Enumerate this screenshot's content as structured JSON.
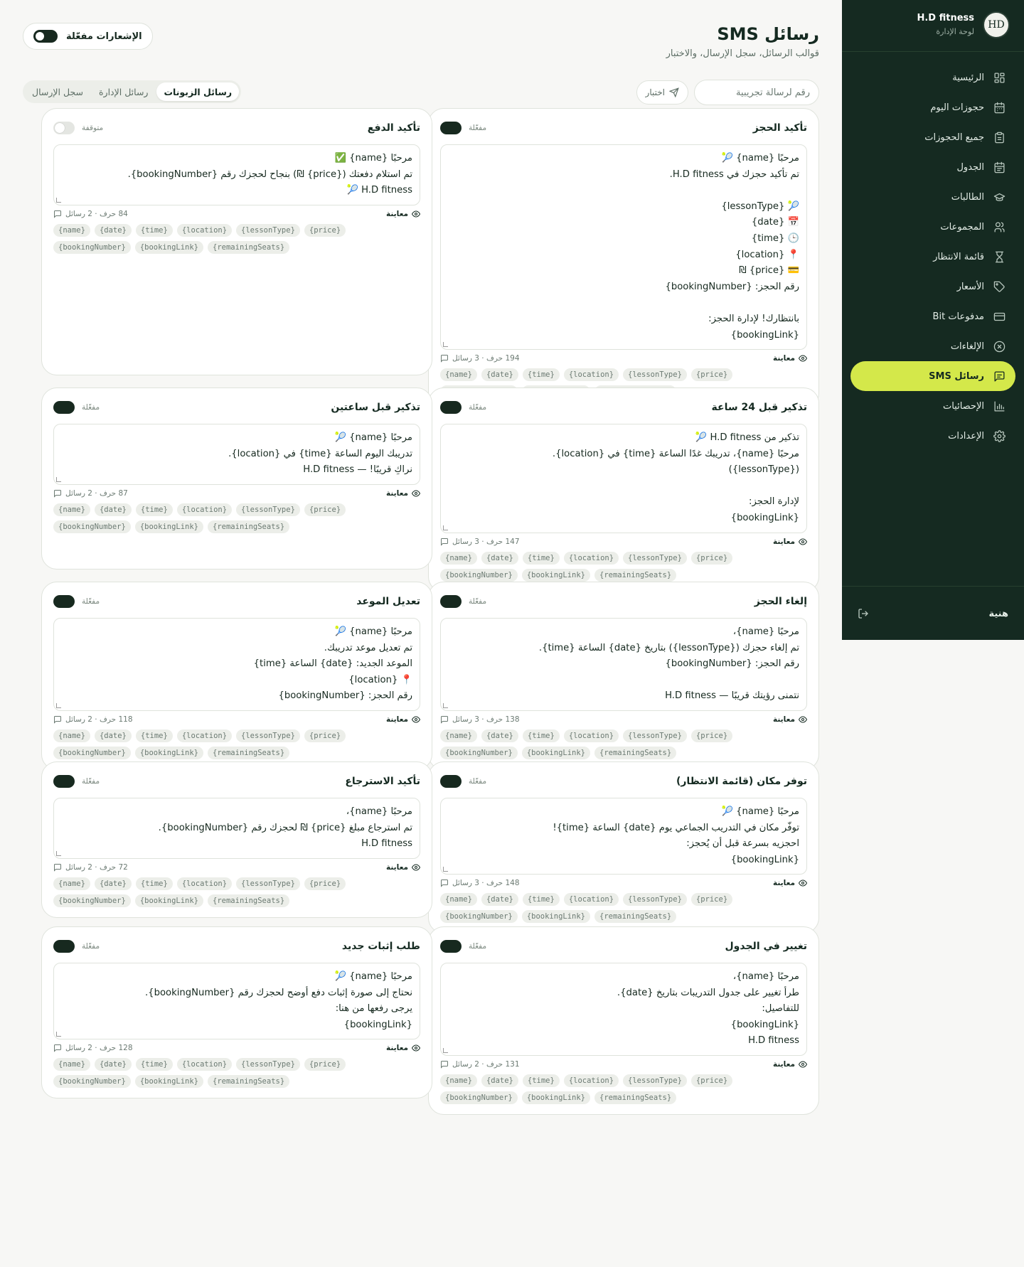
{
  "sidebar": {
    "brand_name": "H.D fitness",
    "brand_sub": "لوحة الإدارة",
    "logo_text": "HD",
    "items": [
      {
        "label": "الرئيسية",
        "icon": "dashboard-icon"
      },
      {
        "label": "حجوزات اليوم",
        "icon": "calendar-today-icon"
      },
      {
        "label": "جميع الحجوزات",
        "icon": "clipboard-icon"
      },
      {
        "label": "الجدول",
        "icon": "calendar-icon"
      },
      {
        "label": "الطالبات",
        "icon": "graduation-cap-icon"
      },
      {
        "label": "المجموعات",
        "icon": "users-icon"
      },
      {
        "label": "قائمة الانتظار",
        "icon": "hourglass-icon"
      },
      {
        "label": "الأسعار",
        "icon": "tag-icon"
      },
      {
        "label": "مدفوعات Bit",
        "icon": "credit-card-icon"
      },
      {
        "label": "الإلغاءات",
        "icon": "x-circle-icon"
      },
      {
        "label": "رسائل SMS",
        "icon": "message-icon",
        "active": true
      },
      {
        "label": "الإحصائيات",
        "icon": "bar-chart-icon"
      },
      {
        "label": "الإعدادات",
        "icon": "gear-icon"
      }
    ],
    "user_name": "هنية"
  },
  "header": {
    "title": "رسائل SMS",
    "subtitle": "قوالب الرسائل، سجل الإرسال، والاختبار",
    "notif_label": "الإشعارات مفعّلة"
  },
  "test": {
    "button_label": "اختبار",
    "input_placeholder": "رقم لرسالة تجريبية"
  },
  "tabs": [
    {
      "label": "رسائل الزبونات",
      "active": true
    },
    {
      "label": "رسائل الإدارة",
      "active": false
    },
    {
      "label": "سجل الإرسال",
      "active": false
    }
  ],
  "preview_label": "معاينة",
  "variables": [
    "{name}",
    "{date}",
    "{time}",
    "{location}",
    "{lessonType}",
    "{price}",
    "{bookingNumber}",
    "{bookingLink}",
    "{remainingSeats}"
  ],
  "cards": [
    {
      "title": "تأكيد الحجز",
      "state": "مفعّلة",
      "enabled": true,
      "body": "مرحبًا {name} 🎾\nتم تأكيد حجزك في H.D fitness.\n\n🎾 {lessonType}\n📅 {date}\n🕒 {time}\n📍 {location}\n💳 {price} ₪\nرقم الحجز: {bookingNumber}\n\nبانتظارك! لإدارة الحجز:\n{bookingLink}",
      "count": "194 حرف · 3 رسائل"
    },
    {
      "title": "تأكيد الدفع",
      "state": "متوقفة",
      "enabled": false,
      "body": "مرحبًا {name} ✅\nتم استلام دفعتك ({price} ₪) بنجاح لحجزك رقم {bookingNumber}.\nH.D fitness 🎾",
      "count": "84 حرف · 2 رسائل"
    },
    {
      "title": "تذكير قبل 24 ساعة",
      "state": "مفعّلة",
      "enabled": true,
      "body": "تذكير من H.D fitness 🎾\nمرحبًا {name}، تدريبك غدًا الساعة {time} في {location}.\n({lessonType})\n\nلإدارة الحجز:\n{bookingLink}",
      "count": "147 حرف · 3 رسائل"
    },
    {
      "title": "تذكير قبل ساعتين",
      "state": "مفعّلة",
      "enabled": true,
      "body": "مرحبًا {name} 🎾\nتدريبك اليوم الساعة {time} في {location}.\nنراكِ قريبًا! — H.D fitness",
      "count": "87 حرف · 2 رسائل"
    },
    {
      "title": "إلغاء الحجز",
      "state": "مفعّلة",
      "enabled": true,
      "body": "مرحبًا {name}،\nتم إلغاء حجزك ({lessonType}) بتاريخ {date} الساعة {time}.\nرقم الحجز: {bookingNumber}\n\nنتمنى رؤيتك قريبًا — H.D fitness",
      "count": "138 حرف · 3 رسائل"
    },
    {
      "title": "تعديل الموعد",
      "state": "مفعّلة",
      "enabled": true,
      "body": "مرحبًا {name} 🎾\nتم تعديل موعد تدريبك.\nالموعد الجديد: {date} الساعة {time}\n📍 {location}\nرقم الحجز: {bookingNumber}",
      "count": "118 حرف · 2 رسائل"
    },
    {
      "title": "توفر مكان (قائمة الانتظار)",
      "state": "مفعّلة",
      "enabled": true,
      "body": "مرحبًا {name} 🎾\nتوفّر مكان في التدريب الجماعي يوم {date} الساعة {time}!\nاحجزيه بسرعة قبل أن يُحجز:\n{bookingLink}",
      "count": "148 حرف · 3 رسائل"
    },
    {
      "title": "تأكيد الاسترجاع",
      "state": "مفعّلة",
      "enabled": true,
      "body": "مرحبًا {name}،\nتم استرجاع مبلغ {price} ₪ لحجزك رقم {bookingNumber}.\nH.D fitness",
      "count": "72 حرف · 2 رسائل"
    },
    {
      "title": "تغيير في الجدول",
      "state": "مفعّلة",
      "enabled": true,
      "body": "مرحبًا {name}،\nطرأ تغيير على جدول التدريبات بتاريخ {date}.\nللتفاصيل:\n{bookingLink}\nH.D fitness",
      "count": "131 حرف · 2 رسائل"
    },
    {
      "title": "طلب إثبات جديد",
      "state": "مفعّلة",
      "enabled": true,
      "body": "مرحبًا {name} 🎾\nنحتاج إلى صورة إثبات دفع أوضح لحجزك رقم {bookingNumber}.\nيرجى رفعها من هنا:\n{bookingLink}",
      "count": "128 حرف · 2 رسائل"
    }
  ]
}
